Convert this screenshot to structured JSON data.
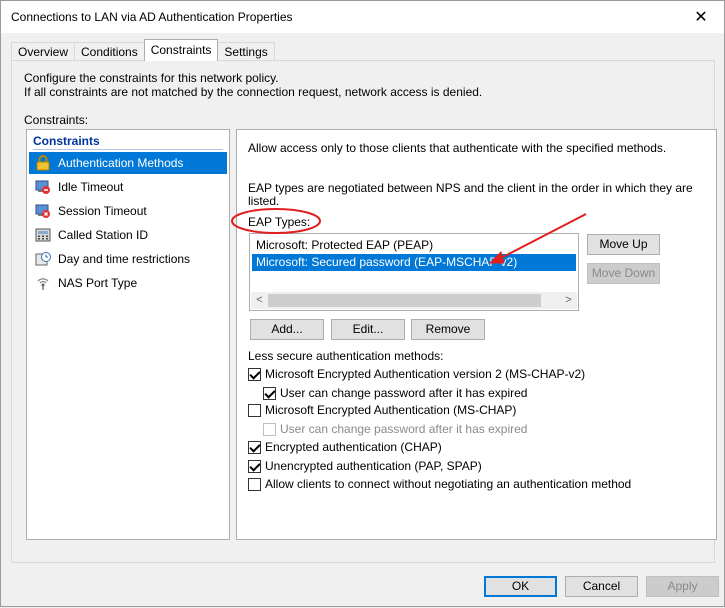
{
  "window": {
    "title": "Connections to LAN via AD Authentication Properties"
  },
  "tabs": [
    {
      "label": "Overview",
      "active": false
    },
    {
      "label": "Conditions",
      "active": false
    },
    {
      "label": "Constraints",
      "active": true
    },
    {
      "label": "Settings",
      "active": false
    }
  ],
  "intro": {
    "line1": "Configure the constraints for this network policy.",
    "line2": "If all constraints are not matched by the connection request, network access is denied."
  },
  "constraints_label": "Constraints:",
  "left_list": {
    "header": "Constraints",
    "items": [
      {
        "label": "Authentication Methods",
        "icon": "lock-icon",
        "selected": true
      },
      {
        "label": "Idle Timeout",
        "icon": "idle-timeout-icon",
        "selected": false
      },
      {
        "label": "Session Timeout",
        "icon": "session-timeout-icon",
        "selected": false
      },
      {
        "label": "Called Station ID",
        "icon": "phone-icon",
        "selected": false
      },
      {
        "label": "Day and time restrictions",
        "icon": "clock-icon",
        "selected": false
      },
      {
        "label": "NAS Port Type",
        "icon": "network-port-icon",
        "selected": false
      }
    ]
  },
  "right": {
    "description": "Allow access only to those clients that authenticate with the specified methods.",
    "eap_desc_line1": "EAP types are negotiated between NPS and the client in the order in which they are",
    "eap_desc_line2": "listed.",
    "eap_types_label": "EAP Types:",
    "eap_types": [
      {
        "label": "Microsoft: Protected EAP (PEAP)",
        "selected": false
      },
      {
        "label": "Microsoft: Secured password (EAP-MSCHAP v2)",
        "selected": true
      }
    ],
    "move_up": "Move Up",
    "move_down": "Move Down",
    "add": "Add...",
    "edit": "Edit...",
    "remove": "Remove",
    "less_secure_label": "Less secure authentication methods:",
    "checkboxes": [
      {
        "label": "Microsoft Encrypted Authentication version 2 (MS-CHAP-v2)",
        "checked": true,
        "disabled": false
      },
      {
        "label": "User can change password after it has expired",
        "checked": true,
        "disabled": false
      },
      {
        "label": "Microsoft Encrypted Authentication (MS-CHAP)",
        "checked": false,
        "disabled": false
      },
      {
        "label": "User can change password after it has expired",
        "checked": false,
        "disabled": true
      },
      {
        "label": "Encrypted authentication (CHAP)",
        "checked": true,
        "disabled": false
      },
      {
        "label": "Unencrypted authentication (PAP, SPAP)",
        "checked": true,
        "disabled": false
      },
      {
        "label": "Allow clients to connect without negotiating an authentication method",
        "checked": false,
        "disabled": false
      }
    ]
  },
  "footer": {
    "ok": "OK",
    "cancel": "Cancel",
    "apply": "Apply"
  },
  "colors": {
    "selection": "#0078d7",
    "annotation": "#e02020",
    "header": "#003399"
  }
}
